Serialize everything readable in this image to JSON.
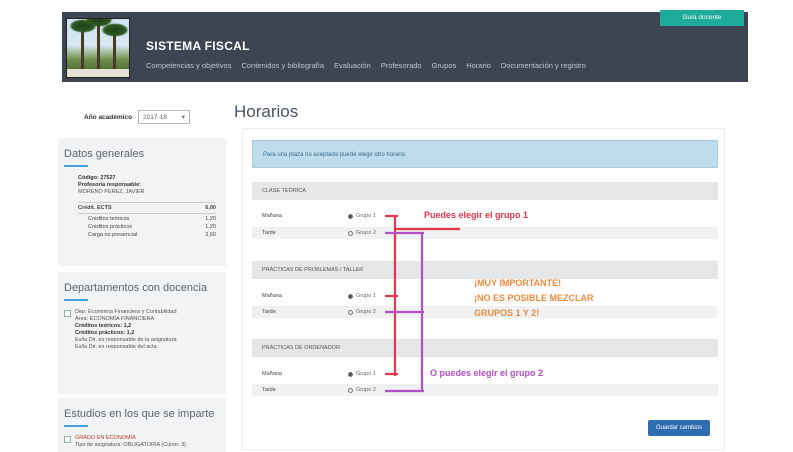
{
  "header": {
    "app_title": "SISTEMA FISCAL",
    "nav": [
      "Competencias y objetivos",
      "Contenidos y bibliografía",
      "Evaluación",
      "Profesorado",
      "Grupos",
      "Horario",
      "Documentación y registro"
    ],
    "top_button": "Guía docente",
    "colors": {
      "header_bg": "#3d4552",
      "accent": "#1fab9a"
    }
  },
  "sidebar": {
    "year_label": "Año académico",
    "year_value": "2017-18",
    "general": {
      "title": "Datos generales",
      "codigo": "Código: 27527",
      "profesor": "Profesor/a responsable:",
      "profesor_nombre": "MORENO PEREZ, JAVIER",
      "credits_label": "Crédit. ECTS",
      "credits_value": "6,00",
      "rows": [
        {
          "label": "Créditos teóricos",
          "value": "1,20"
        },
        {
          "label": "Créditos prácticos",
          "value": "1,20"
        },
        {
          "label": "Carga no presencial",
          "value": "3,60"
        }
      ]
    },
    "departments": {
      "title": "Departamentos con docencia",
      "lines": [
        "Dep. Economía Financiera y Contabilidad",
        "Área: ECONOMÍA FINANCIERA",
        "Créditos teóricos: 1,2",
        "Créditos prácticos: 1,2",
        "Es/la Dir. es responsable de la asignatura",
        "Es/la Dir. es responsable del acta"
      ]
    },
    "studies": {
      "title": "Estudios en los que se imparte",
      "lines": [
        "GRADO EN ECONOMÍA",
        "Tipo de asignatura: OBLIGATORIA (Curso: 3)"
      ]
    }
  },
  "main": {
    "title": "Horarios",
    "info_text": "Para una plaza no aceptada puede elegir otro horario",
    "sections": [
      {
        "heading": "CLASE TEÓRICA",
        "rows": [
          {
            "label": "Mañana",
            "option": "Grupo 1",
            "selected": true
          },
          {
            "label": "Tarde",
            "option": "Grupo 2",
            "selected": false
          }
        ]
      },
      {
        "heading": "PRÁCTICAS DE PROBLEMAS / TALLER",
        "rows": [
          {
            "label": "Mañana",
            "option": "Grupo 1",
            "selected": true
          },
          {
            "label": "Tarde",
            "option": "Grupo 2",
            "selected": false
          }
        ]
      },
      {
        "heading": "PRÁCTICAS DE ORDENADOR",
        "rows": [
          {
            "label": "Mañana",
            "option": "Grupo 1",
            "selected": true
          },
          {
            "label": "Tarde",
            "option": "Grupo 2",
            "selected": false
          }
        ]
      }
    ],
    "save_button": "Guardar cambios"
  },
  "annotations": {
    "red_note": "Puedes elegir el grupo 1",
    "orange_note": [
      "¡MUY IMPORTANTE!",
      "¡NO ES POSIBLE MEZCLAR",
      "GRUPOS 1 Y 2!"
    ],
    "purple_note": "O puedes elegir el grupo 2",
    "colors": {
      "red": "#e5364b",
      "orange": "#f08a3c",
      "purple": "#b54fc8"
    }
  }
}
